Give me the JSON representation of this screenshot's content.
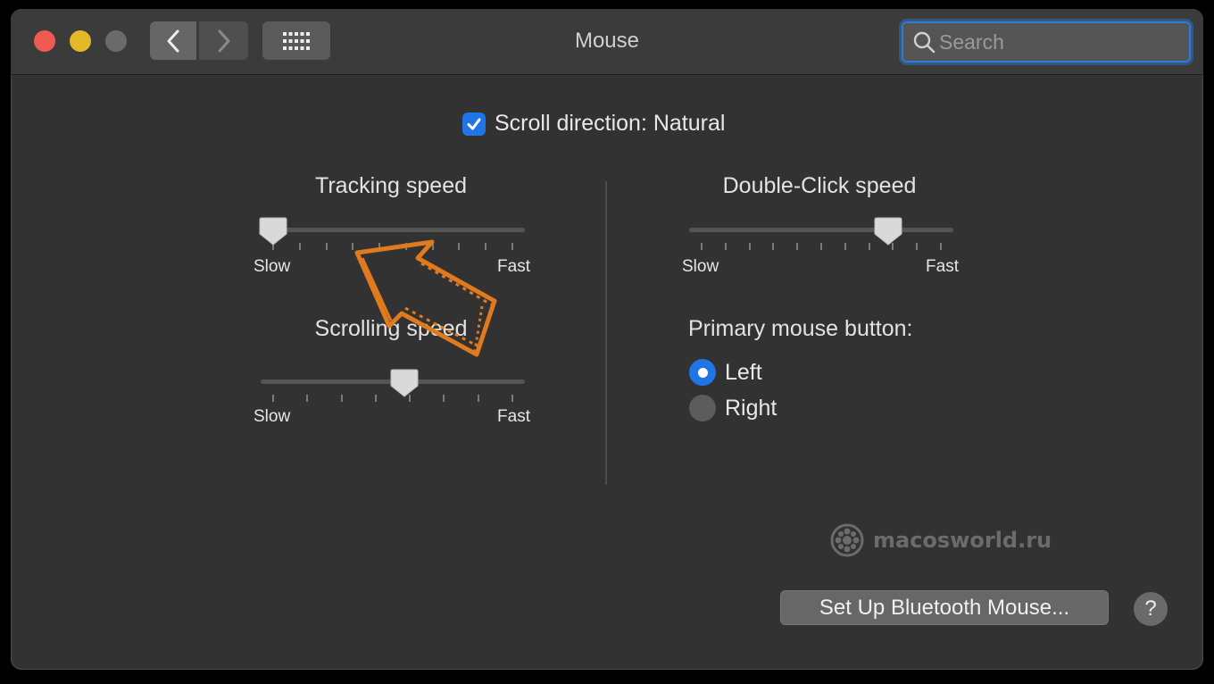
{
  "window": {
    "title": "Mouse",
    "search_placeholder": "Search"
  },
  "scroll_direction": {
    "label": "Scroll direction: Natural",
    "checked": true
  },
  "tracking_speed": {
    "title": "Tracking speed",
    "min_label": "Slow",
    "max_label": "Fast",
    "value_fraction": 0.0,
    "tick_count": 10
  },
  "scrolling_speed": {
    "title": "Scrolling speed",
    "min_label": "Slow",
    "max_label": "Fast",
    "value_fraction": 0.55,
    "tick_count": 8
  },
  "double_click_speed": {
    "title": "Double-Click speed",
    "min_label": "Slow",
    "max_label": "Fast",
    "value_fraction": 0.78,
    "tick_count": 11
  },
  "primary_button": {
    "title": "Primary mouse button:",
    "options": [
      {
        "label": "Left",
        "selected": true
      },
      {
        "label": "Right",
        "selected": false
      }
    ]
  },
  "watermark": "macosworld.ru",
  "bluetooth_button": "Set Up Bluetooth Mouse...",
  "help_label": "?",
  "colors": {
    "accent": "#1f74e6",
    "annotation_arrow": "#e07a1f",
    "close": "#ee5a52",
    "minimize": "#e3b927"
  },
  "icons": [
    "back-chevron-icon",
    "forward-chevron-icon",
    "grid-icon",
    "search-icon",
    "checkmark-icon",
    "help-icon",
    "watermark-logo-icon",
    "annotation-arrow-icon"
  ]
}
